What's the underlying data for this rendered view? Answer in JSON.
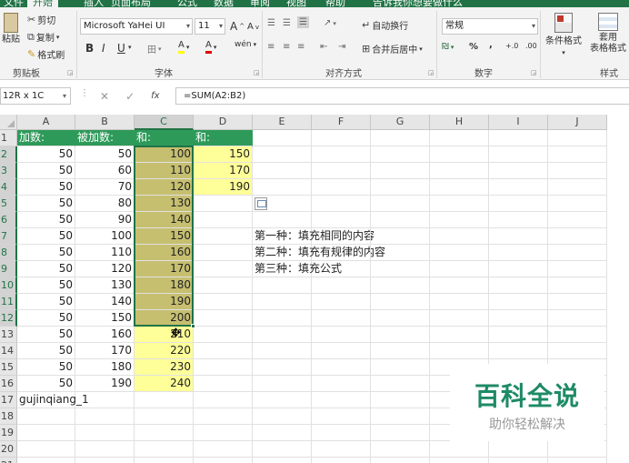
{
  "title_tabs": [
    "文件",
    "开始",
    "插入",
    "页面布局",
    "公式",
    "数据",
    "审阅",
    "视图",
    "帮助",
    "告诉我你想要做什么"
  ],
  "ribbon": {
    "clipboard": {
      "paste": "粘贴",
      "cut": "剪切",
      "copy": "复制",
      "format_painter": "格式刷",
      "label": "剪贴板"
    },
    "font": {
      "name": "Microsoft YaHei UI",
      "size": "11",
      "grow": "A",
      "shrink": "A",
      "bold": "B",
      "italic": "I",
      "underline": "U",
      "border": "田",
      "fill": "A",
      "color": "A",
      "phonetic": "wén",
      "label": "字体"
    },
    "alignment": {
      "wrap": "自动换行",
      "merge": "合并后居中",
      "label": "对齐方式"
    },
    "number": {
      "format": "常规",
      "percent": "%",
      "comma": ",",
      "increase_decimal": "+.0",
      "decrease_decimal": ".00",
      "label": "数字"
    },
    "styles": {
      "conditional": "条件格式",
      "table": "套用",
      "table2": "表格格式",
      "label": "样式"
    }
  },
  "formula_bar": {
    "name_box": "12R x 1C",
    "fx": "fx",
    "formula": "=SUM(A2:B2)"
  },
  "columns": [
    "A",
    "B",
    "C",
    "D",
    "E",
    "F",
    "G",
    "H",
    "I",
    "J"
  ],
  "rows": [
    "1",
    "2",
    "3",
    "4",
    "5",
    "6",
    "7",
    "8",
    "9",
    "10",
    "11",
    "12",
    "13",
    "14",
    "15",
    "16",
    "17",
    "18",
    "19",
    "20",
    "21"
  ],
  "headers": {
    "a1": "加数:",
    "b1": "被加数:",
    "c1": "和:",
    "d1": "和:"
  },
  "col_a": [
    "50",
    "50",
    "50",
    "50",
    "50",
    "50",
    "50",
    "50",
    "50",
    "50",
    "50",
    "50",
    "50",
    "50",
    "50"
  ],
  "col_b": [
    "50",
    "60",
    "70",
    "80",
    "90",
    "100",
    "110",
    "120",
    "130",
    "140",
    "150",
    "160",
    "170",
    "180",
    "190"
  ],
  "col_c": [
    "100",
    "110",
    "120",
    "130",
    "140",
    "150",
    "160",
    "170",
    "180",
    "190",
    "200",
    "210",
    "220",
    "230",
    "240"
  ],
  "col_d": [
    "150",
    "170",
    "190"
  ],
  "notes": [
    "第一种：填充相同的内容",
    "第二种：填充有规律的内容",
    "第三种：填充公式"
  ],
  "a17": "gujinqiang_1",
  "watermark": {
    "title": "百科全说",
    "subtitle": "助你轻松解决"
  },
  "colors": {
    "accent": "#217346",
    "header_fill": "#2e9a5a",
    "yellow": "#ffff99",
    "selection_fill": "#c6bf70"
  }
}
